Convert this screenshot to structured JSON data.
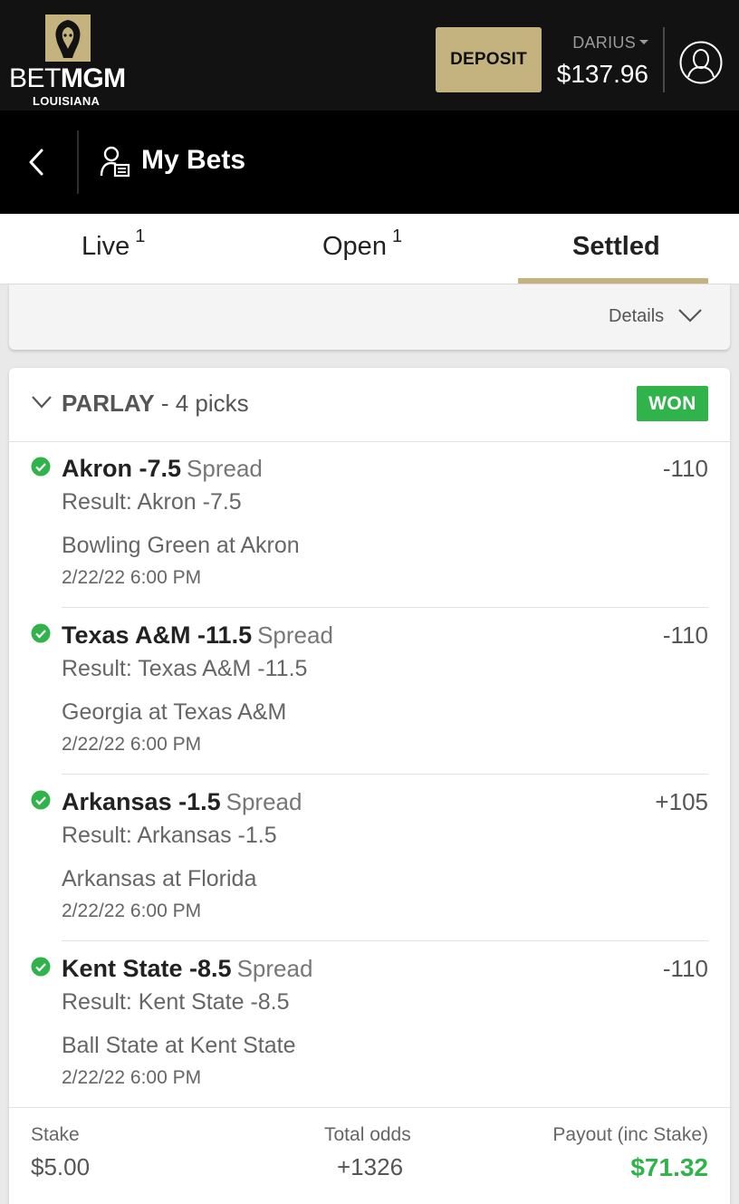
{
  "header": {
    "brand_bet": "BET",
    "brand_mgm": "MGM",
    "brand_state": "LOUISIANA",
    "deposit_label": "DEPOSIT",
    "username": "DARIUS",
    "balance": "$137.96"
  },
  "subheader": {
    "title": "My Bets"
  },
  "tabs": [
    {
      "label": "Live",
      "count": "1",
      "active": false
    },
    {
      "label": "Open",
      "count": "1",
      "active": false
    },
    {
      "label": "Settled",
      "count": "",
      "active": true
    }
  ],
  "details": {
    "label": "Details"
  },
  "bet": {
    "type_label": "PARLAY",
    "picks_label": "- 4 picks",
    "status": "WON",
    "status_color": "#2fb34a",
    "picks": [
      {
        "selection": "Akron -7.5",
        "market": "Spread",
        "odds": "-110",
        "result": "Result: Akron -7.5",
        "event": "Bowling Green at Akron",
        "date": "2/22/22 6:00 PM"
      },
      {
        "selection": "Texas A&M -11.5",
        "market": "Spread",
        "odds": "-110",
        "result": "Result: Texas A&M -11.5",
        "event": "Georgia at Texas A&M",
        "date": "2/22/22 6:00 PM"
      },
      {
        "selection": "Arkansas -1.5",
        "market": "Spread",
        "odds": "+105",
        "result": "Result: Arkansas -1.5",
        "event": "Arkansas at Florida",
        "date": "2/22/22 6:00 PM"
      },
      {
        "selection": "Kent State -8.5",
        "market": "Spread",
        "odds": "-110",
        "result": "Result: Kent State -8.5",
        "event": "Ball State at Kent State",
        "date": "2/22/22 6:00 PM"
      }
    ],
    "footer": {
      "stake_label": "Stake",
      "stake_value": "$5.00",
      "odds_label": "Total odds",
      "odds_value": "+1326",
      "payout_label": "Payout (inc Stake)",
      "payout_value": "$71.32"
    }
  },
  "colors": {
    "accent_gold": "#c4b27f",
    "won_green": "#2fb34a",
    "header_bg": "#121212"
  }
}
